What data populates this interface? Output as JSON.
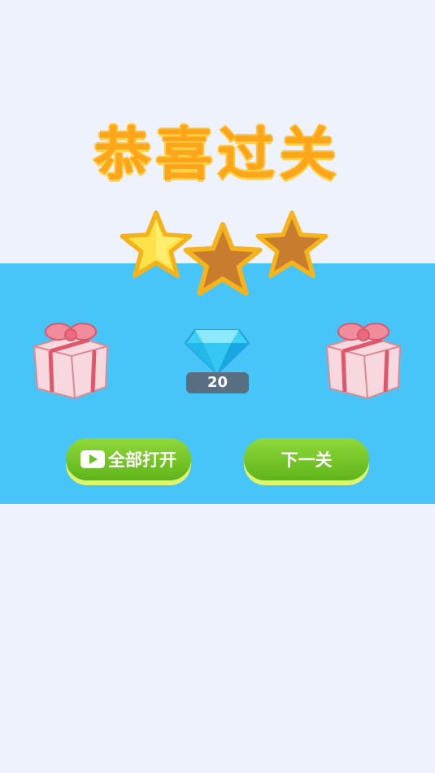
{
  "title": "恭喜过关",
  "stars": {
    "earned": 1,
    "total": 3
  },
  "reward": {
    "gem_count": "20"
  },
  "buttons": {
    "open_all": "全部打开",
    "next_level": "下一关"
  },
  "colors": {
    "panel": "#47c5f8",
    "title": "#ffa51a",
    "star_earned": "#ffe24a",
    "star_empty": "#c87d2e",
    "button": "#6cc024",
    "gift": "#f7d8de"
  },
  "icons": [
    "star-icon",
    "gift-box-icon",
    "diamond-icon",
    "video-play-icon"
  ]
}
